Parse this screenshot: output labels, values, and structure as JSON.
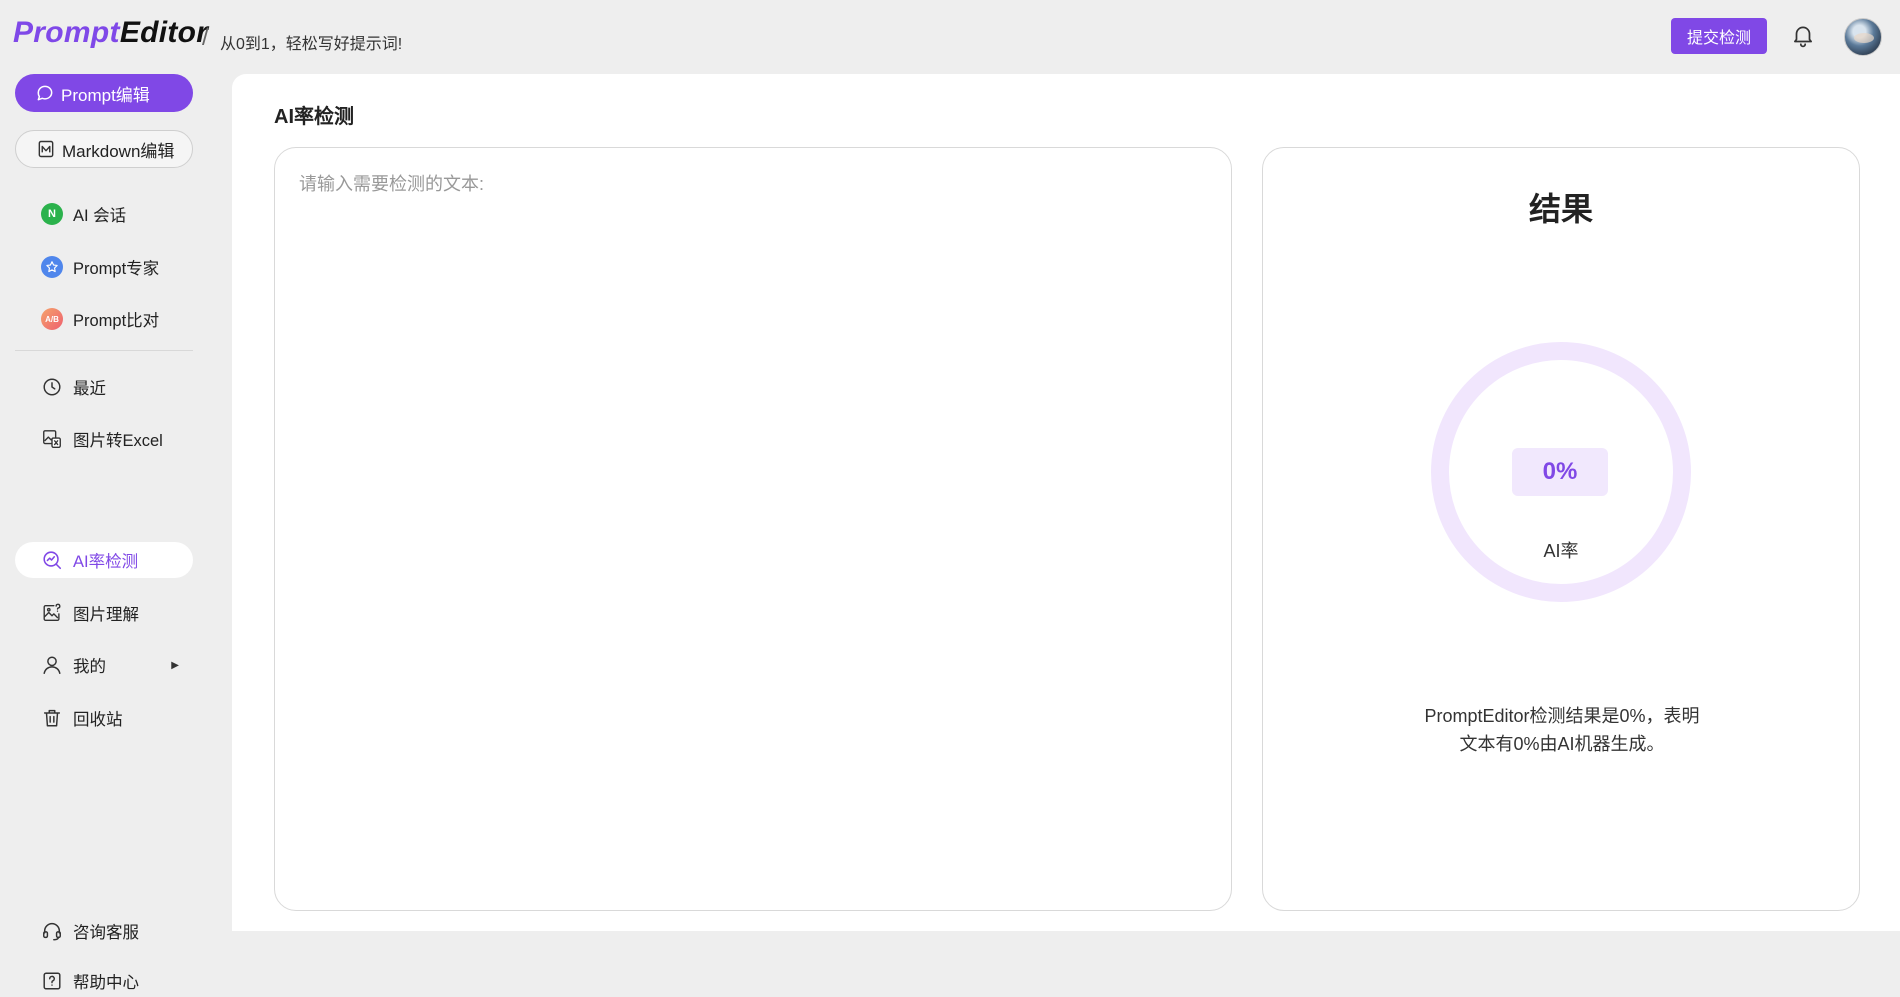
{
  "header": {
    "logo_part1": "Prompt",
    "logo_part2": "Editor",
    "separator": "/",
    "tagline": "从0到1，轻松写好提示词!",
    "submit_button": "提交检测",
    "bell_icon": "bell-icon",
    "avatar": "user-avatar"
  },
  "sidebar": {
    "primary_button": {
      "label": "Prompt编辑",
      "icon": "chat-bubble-icon"
    },
    "secondary_button": {
      "label": "Markdown编辑",
      "icon": "markdown-icon"
    },
    "items": [
      {
        "label": "AI 会话",
        "icon": "ai-chat-icon",
        "icon_text": "N",
        "color": "#2bb24c"
      },
      {
        "label": "Prompt专家",
        "icon": "star-badge-icon",
        "color": "#4f86ec"
      },
      {
        "label": "Prompt比对",
        "icon": "ab-compare-icon",
        "icon_text": "A/B",
        "color": "#f07a5e"
      },
      {
        "label": "最近",
        "icon": "clock-icon"
      },
      {
        "label": "图片转Excel",
        "icon": "image-to-excel-icon"
      },
      {
        "label": "AI率检测",
        "icon": "ai-detect-icon",
        "active": true
      },
      {
        "label": "图片理解",
        "icon": "image-question-icon"
      },
      {
        "label": "我的",
        "icon": "user-icon",
        "has_submenu": true
      },
      {
        "label": "回收站",
        "icon": "trash-icon"
      }
    ],
    "bottom_items": [
      {
        "label": "咨询客服",
        "icon": "headset-icon"
      },
      {
        "label": "帮助中心",
        "icon": "help-icon"
      }
    ]
  },
  "main": {
    "title": "AI率检测",
    "input_placeholder": "请输入需要检测的文本:",
    "result": {
      "title": "结果",
      "percentage": "0%",
      "percentage_value": 0,
      "label": "AI率",
      "description": "PromptEditor检测结果是0%，表明文本有0%由AI机器生成。"
    }
  },
  "colors": {
    "accent": "#8048e6",
    "ring": "#f1e6fd",
    "page_bg": "#eeeeee"
  }
}
